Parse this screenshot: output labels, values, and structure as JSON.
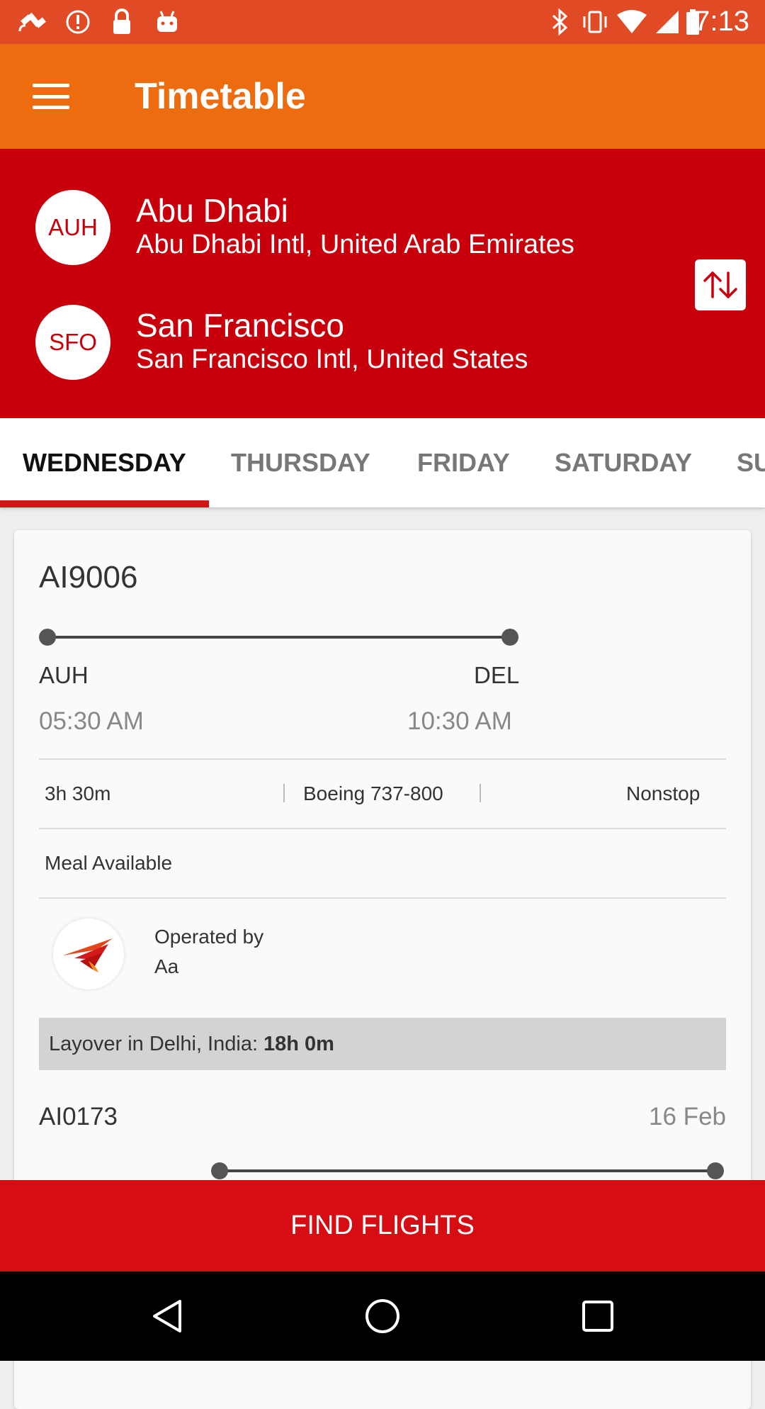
{
  "status_bar": {
    "time": "7:13",
    "left_icons": [
      "satellite-icon",
      "alert-icon",
      "lock-icon",
      "android-icon"
    ],
    "right_icons": [
      "bluetooth-icon",
      "vibrate-icon",
      "wifi-icon",
      "signal-icon",
      "battery-icon"
    ]
  },
  "app_bar": {
    "title": "Timetable"
  },
  "route": {
    "origin": {
      "code": "AUH",
      "city": "Abu Dhabi",
      "airport": "Abu Dhabi Intl, United Arab Emirates"
    },
    "destination": {
      "code": "SFO",
      "city": "San Francisco",
      "airport": "San Francisco Intl, United States"
    }
  },
  "tabs": [
    {
      "label": "WEDNESDAY",
      "selected": true
    },
    {
      "label": "THURSDAY",
      "selected": false
    },
    {
      "label": "FRIDAY",
      "selected": false
    },
    {
      "label": "SATURDAY",
      "selected": false
    },
    {
      "label": "SUNDAY",
      "selected": false
    }
  ],
  "flights": [
    {
      "number": "AI9006",
      "from": "AUH",
      "to": "DEL",
      "depart": "05:30 AM",
      "arrive": "10:30 AM",
      "duration": "3h 30m",
      "aircraft": "Boeing 737-800",
      "stops": "Nonstop",
      "meal": "Meal Available",
      "operated_label": "Operated by",
      "operator": "Aa"
    },
    {
      "number": "AI0173",
      "date": "16 Feb"
    }
  ],
  "layover": {
    "label": "Layover in Delhi, India:",
    "duration": "18h 0m"
  },
  "cta": {
    "label": "FIND FLIGHTS"
  },
  "colors": {
    "status_bar": "#e04a24",
    "app_bar": "#ee6c10",
    "route_panel": "#c8000b",
    "accent": "#d61313",
    "cta": "#d60d12"
  }
}
